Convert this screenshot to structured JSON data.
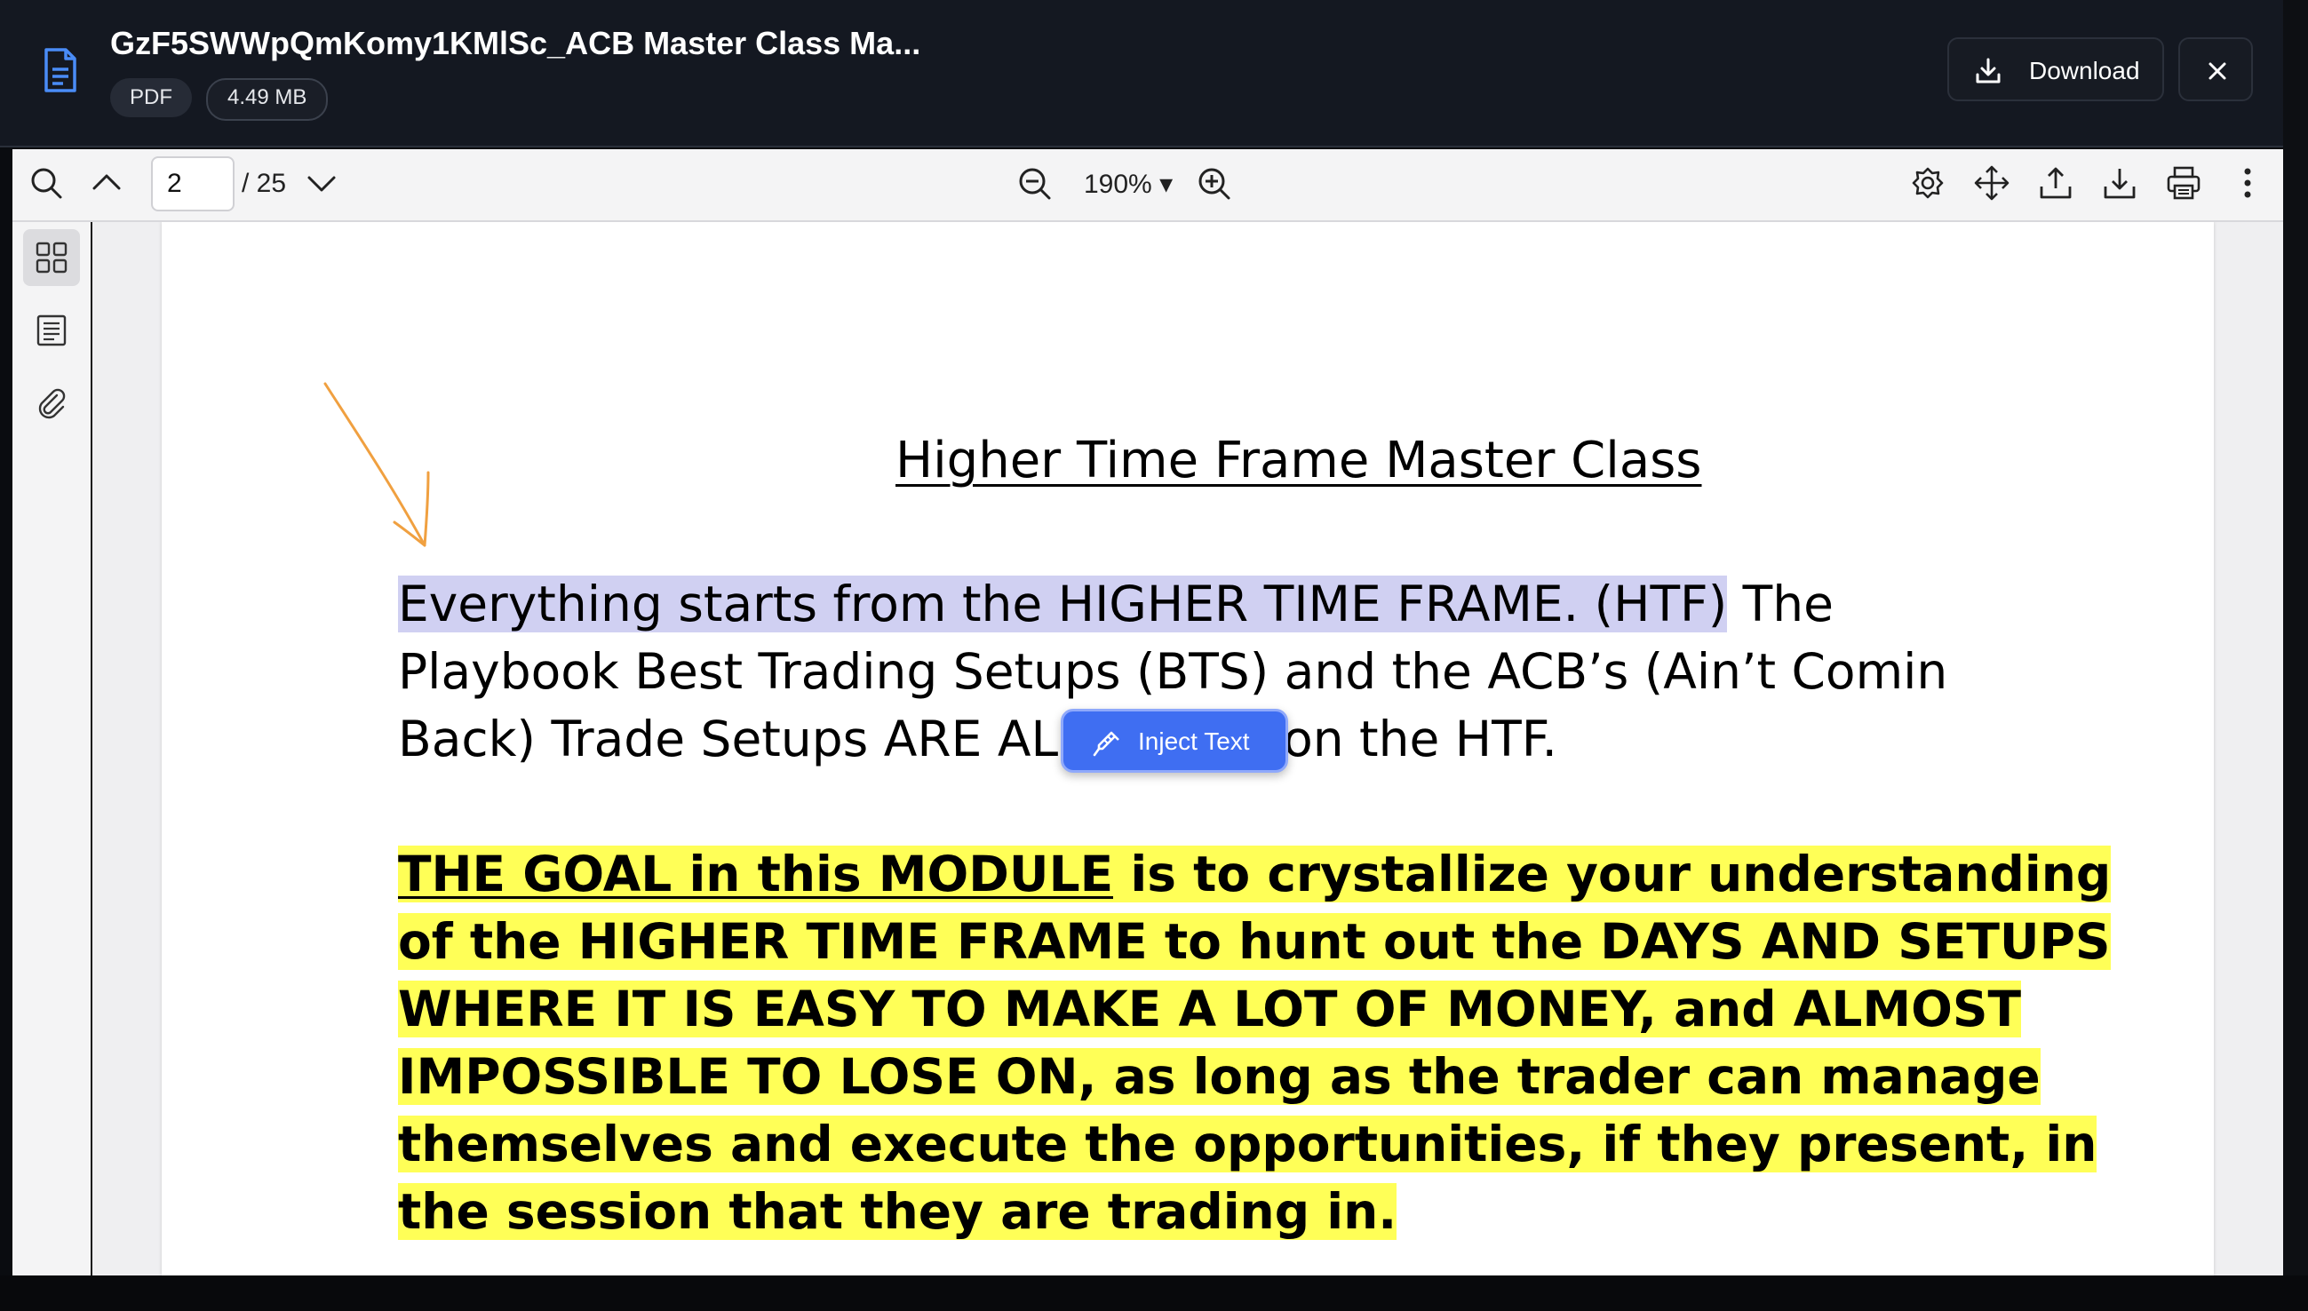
{
  "header": {
    "file_title": "GzF5SWWpQmKomy1KMlSc_ACB Master Class Ma...",
    "file_type": "PDF",
    "file_size": "4.49 MB",
    "download_label": "Download"
  },
  "toolbar": {
    "current_page": "2",
    "total_pages": "/ 25",
    "zoom": "190%",
    "zoom_caret": "▾"
  },
  "document": {
    "title": "Higher Time Frame Master Class",
    "para1_selected": "Everything starts from the HIGHER TIME FRAME. (HTF)",
    "para1_rest": " The Playbook Best Trading Setups (BTS) and the ACB’s (Ain’t Comin Back) Trade Setups ARE ALL BASED on the HTF.",
    "para2_underlined": "THE GOAL in this MODULE",
    "para2_rest": " is to crystallize your understanding of the HIGHER TIME FRAME to hunt out the DAYS AND SETUPS WHERE IT IS EASY TO MAKE A LOT OF MONEY, and ALMOST IMPOSSIBLE TO LOSE ON, as long as the trader can manage themselves and execute the opportunities, if they present, in the session that they are trading in."
  },
  "popup": {
    "inject_label": "Inject Text"
  },
  "colors": {
    "accent": "#3f6ef2",
    "selection": "#d0d0f2",
    "highlight": "#ffff57",
    "arrow": "#f0a040",
    "header_bg": "#141821"
  }
}
